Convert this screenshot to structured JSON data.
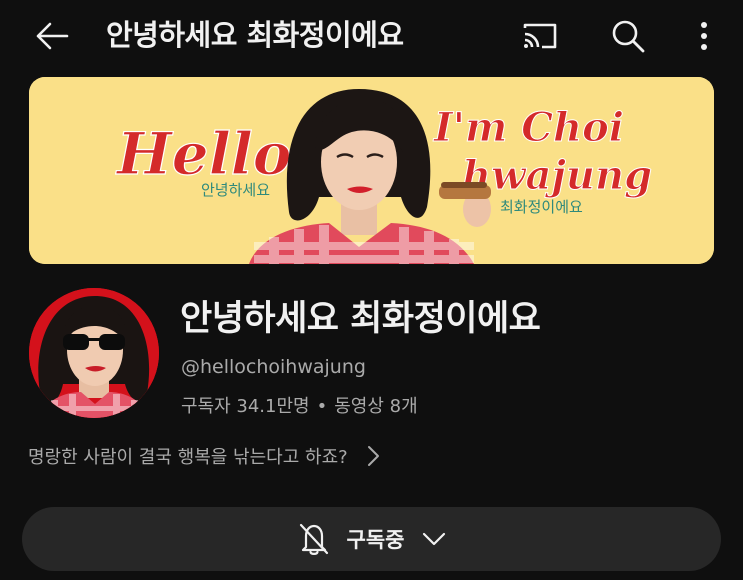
{
  "header": {
    "title": "안녕하세요 최화정이에요",
    "back_icon": "arrow-left-icon",
    "cast_icon": "cast-icon",
    "search_icon": "search-icon",
    "more_icon": "more-vertical-icon"
  },
  "banner": {
    "hello_text": "Hello",
    "im_choi_text": "I'm Choi",
    "hwajung_text": "hwajung",
    "greeting_kr": "안녕하세요",
    "name_kr": "최화정이에요",
    "colors": {
      "background": "#fae088",
      "lettering": "#d42a2a",
      "caption": "#2f8a7c"
    }
  },
  "channel": {
    "name": "안녕하세요 최화정이에요",
    "handle": "@hellochoihwajung",
    "subscribers": "구독자 34.1만명",
    "separator": "•",
    "videos": "동영상 8개",
    "description": "명랑한 사람이 결국 행복을 낚는다고 하죠?"
  },
  "subscribe_button": {
    "label": "구독중",
    "bell_icon": "bell-off-icon",
    "dropdown_icon": "chevron-down-icon"
  }
}
